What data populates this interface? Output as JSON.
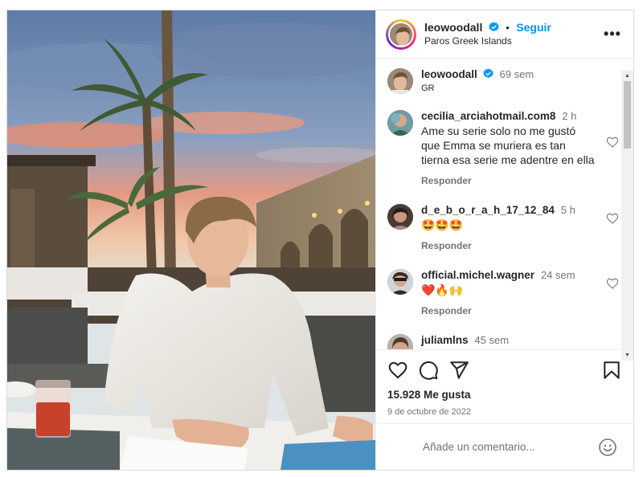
{
  "post": {
    "author": "leowoodall",
    "follow_label": "Seguir",
    "separator": "•",
    "location": "Paros Greek Islands",
    "more_label": "•••"
  },
  "caption": {
    "username": "leowoodall",
    "time": "69 sem",
    "text": "GR"
  },
  "comments": [
    {
      "username": "cecilia_arciahotmail.com8",
      "time": "2 h",
      "text": "Ame su serie solo no me gustó que Emma se muriera es tan tierna esa serie me adentre en ella",
      "reply_label": "Responder"
    },
    {
      "username": "d_e_b_o_r_a_h_17_12_84",
      "time": "5 h",
      "text": "🤩🤩🤩",
      "reply_label": "Responder"
    },
    {
      "username": "official.michel.wagner",
      "time": "24 sem",
      "text": "❤️🔥🙌",
      "reply_label": "Responder"
    },
    {
      "username": "juliamlns",
      "time": "45 sem",
      "text": "",
      "reply_label": ""
    }
  ],
  "stats": {
    "likes": "15.928 Me gusta",
    "date": "9 de octubre de 2022"
  },
  "composer": {
    "placeholder": "Añade un comentario..."
  },
  "icons": {
    "like": "heart-icon",
    "comment": "comment-icon",
    "share": "share-icon",
    "save": "bookmark-icon",
    "emoji": "emoji-icon",
    "verified": "verified-badge-icon"
  },
  "colors": {
    "accent": "#0095f6",
    "text": "#262626",
    "secondary": "#737373",
    "border": "#dbdbdb"
  }
}
